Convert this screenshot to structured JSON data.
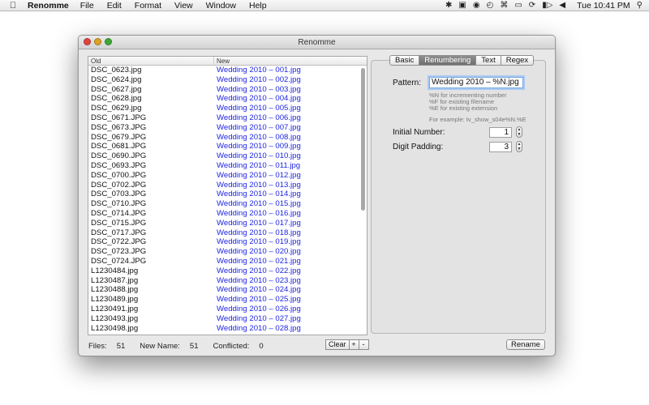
{
  "menubar": {
    "app_name": "Renomme",
    "menus": [
      "File",
      "Edit",
      "Format",
      "View",
      "Window",
      "Help"
    ],
    "clock": "Tue 10:41 PM"
  },
  "window": {
    "title": "Renomme"
  },
  "table": {
    "headers": {
      "old": "Old",
      "new": "New"
    },
    "rows": [
      {
        "old": "DSC_0623.jpg",
        "new": "Wedding 2010 – 001.jpg"
      },
      {
        "old": "DSC_0624.jpg",
        "new": "Wedding 2010 – 002.jpg"
      },
      {
        "old": "DSC_0627.jpg",
        "new": "Wedding 2010 – 003.jpg"
      },
      {
        "old": "DSC_0628.jpg",
        "new": "Wedding 2010 – 004.jpg"
      },
      {
        "old": "DSC_0629.jpg",
        "new": "Wedding 2010 – 005.jpg"
      },
      {
        "old": "DSC_0671.JPG",
        "new": "Wedding 2010 – 006.jpg"
      },
      {
        "old": "DSC_0673.JPG",
        "new": "Wedding 2010 – 007.jpg"
      },
      {
        "old": "DSC_0679.JPG",
        "new": "Wedding 2010 – 008.jpg"
      },
      {
        "old": "DSC_0681.JPG",
        "new": "Wedding 2010 – 009.jpg"
      },
      {
        "old": "DSC_0690.JPG",
        "new": "Wedding 2010 – 010.jpg"
      },
      {
        "old": "DSC_0693.JPG",
        "new": "Wedding 2010 – 011.jpg"
      },
      {
        "old": "DSC_0700.JPG",
        "new": "Wedding 2010 – 012.jpg"
      },
      {
        "old": "DSC_0702.JPG",
        "new": "Wedding 2010 – 013.jpg"
      },
      {
        "old": "DSC_0703.JPG",
        "new": "Wedding 2010 – 014.jpg"
      },
      {
        "old": "DSC_0710.JPG",
        "new": "Wedding 2010 – 015.jpg"
      },
      {
        "old": "DSC_0714.JPG",
        "new": "Wedding 2010 – 016.jpg"
      },
      {
        "old": "DSC_0715.JPG",
        "new": "Wedding 2010 – 017.jpg"
      },
      {
        "old": "DSC_0717.JPG",
        "new": "Wedding 2010 – 018.jpg"
      },
      {
        "old": "DSC_0722.JPG",
        "new": "Wedding 2010 – 019.jpg"
      },
      {
        "old": "DSC_0723.JPG",
        "new": "Wedding 2010 – 020.jpg"
      },
      {
        "old": "DSC_0724.JPG",
        "new": "Wedding 2010 – 021.jpg"
      },
      {
        "old": "L1230484.jpg",
        "new": "Wedding 2010 – 022.jpg"
      },
      {
        "old": "L1230487.jpg",
        "new": "Wedding 2010 – 023.jpg"
      },
      {
        "old": "L1230488.jpg",
        "new": "Wedding 2010 – 024.jpg"
      },
      {
        "old": "L1230489.jpg",
        "new": "Wedding 2010 – 025.jpg"
      },
      {
        "old": "L1230491.jpg",
        "new": "Wedding 2010 – 026.jpg"
      },
      {
        "old": "L1230493.jpg",
        "new": "Wedding 2010 – 027.jpg"
      },
      {
        "old": "L1230498.jpg",
        "new": "Wedding 2010 – 028.jpg"
      }
    ]
  },
  "status": {
    "files_label": "Files:",
    "files_value": "51",
    "new_name_label": "New Name:",
    "new_name_value": "51",
    "conflicted_label": "Conflicted:",
    "conflicted_value": "0",
    "clear_label": "Clear",
    "add_label": "+",
    "remove_label": "-"
  },
  "tabs": [
    "Basic",
    "Renumbering",
    "Text",
    "Regex"
  ],
  "active_tab": "Renumbering",
  "renumbering": {
    "pattern_label": "Pattern:",
    "pattern_value": "Wedding 2010 – %N.jpg",
    "help_lines": [
      "%N for incrementing number",
      "%F for existing filename",
      "%E for existing extension"
    ],
    "example": "For example: tv_show_s04e%N.%E",
    "initial_number_label": "Initial Number:",
    "initial_number_value": "1",
    "digit_padding_label": "Digit Padding:",
    "digit_padding_value": "3"
  },
  "rename_button": "Rename",
  "colors": {
    "new_name_text": "#1f26e0",
    "active_tab": "#7a7a7a"
  }
}
